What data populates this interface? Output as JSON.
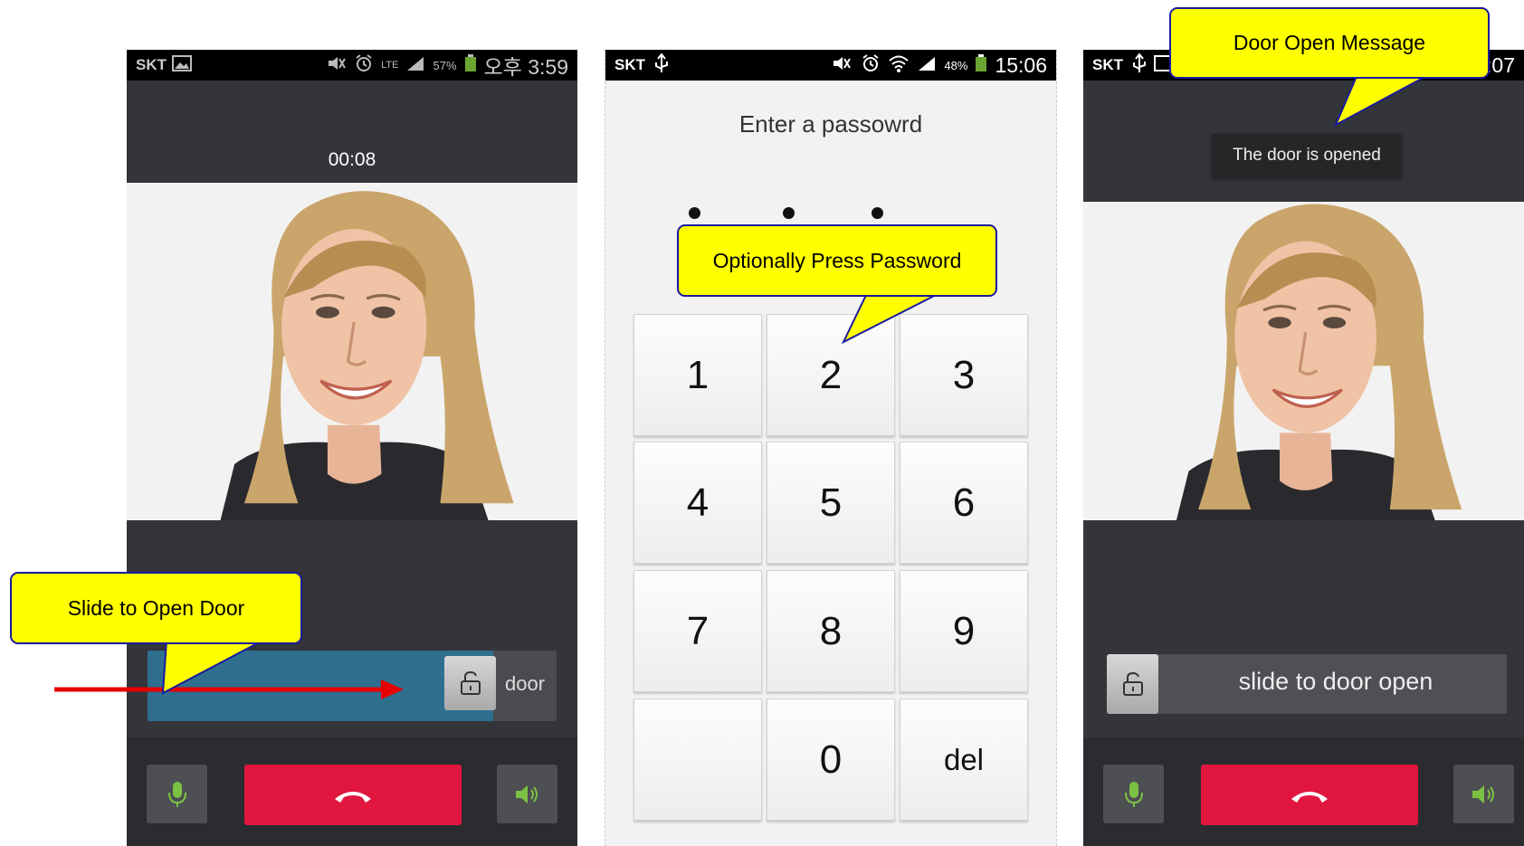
{
  "screen1": {
    "status": {
      "carrier": "SKT",
      "lte": "LTE",
      "battery": "57%",
      "time": "오후 3:59"
    },
    "call_timer": "00:08",
    "slider_label": "door",
    "callout": "Slide to Open Door"
  },
  "screen2": {
    "status": {
      "carrier": "SKT",
      "battery": "48%",
      "time": "15:06"
    },
    "title": "Enter a passowrd",
    "callout": "Optionally Press Password",
    "keys": [
      "1",
      "2",
      "3",
      "4",
      "5",
      "6",
      "7",
      "8",
      "9",
      "",
      "0",
      "del"
    ]
  },
  "screen3": {
    "status": {
      "carrier": "SKT",
      "time_fragment": ":07"
    },
    "toast": "The door is opened",
    "slider_label": "slide to door open",
    "callout": "Door Open Message"
  },
  "colors": {
    "end_call": "#e0163f",
    "slider_fill": "#2f6e8f",
    "callout_fill": "#ffff00",
    "arrow": "#e60000",
    "mic_speaker": "#7cc242"
  },
  "icons": [
    "lock-open-icon",
    "mic-icon",
    "end-call-icon",
    "speaker-icon",
    "usb-icon",
    "alarm-icon",
    "wifi-icon",
    "signal-icon",
    "battery-icon",
    "mute-icon",
    "image-icon"
  ]
}
